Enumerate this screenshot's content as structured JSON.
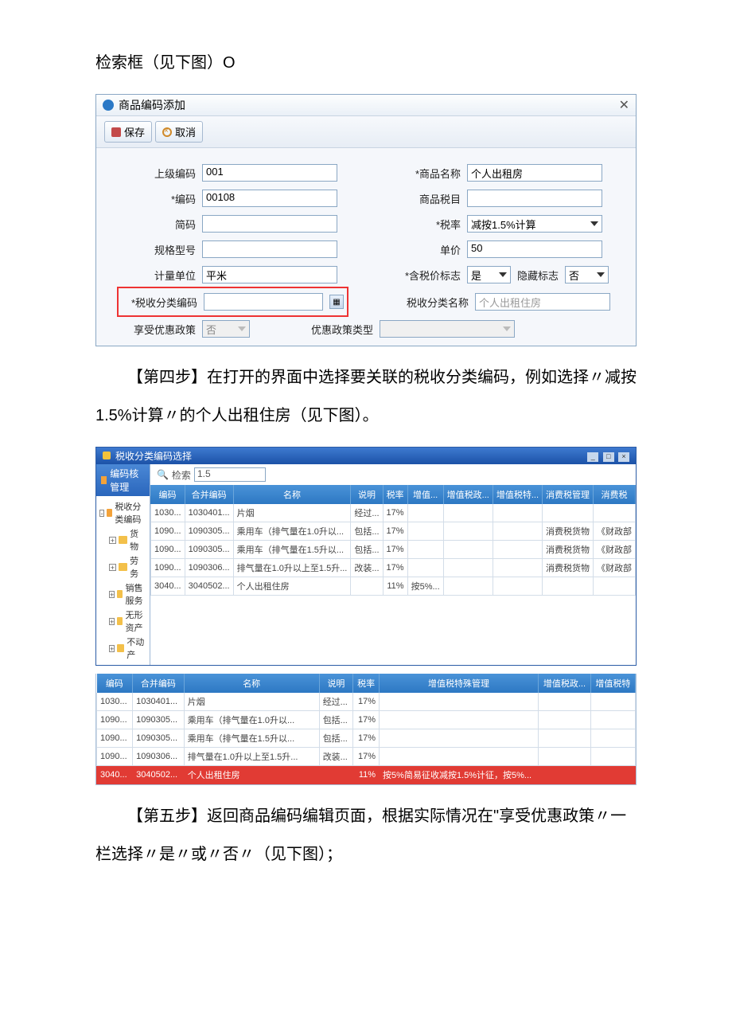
{
  "text1": "检索框（见下图）O",
  "text2": "【第四步】在打开的界面中选择要关联的税收分类编码，例如选择〃减按 1.5%计算〃的个人出租住房（见下图）。",
  "text3": "【第五步】返回商品编码编辑页面，根据实际情况在\"享受优惠政策〃一栏选择〃是〃或〃否〃（见下图）；",
  "dialog1": {
    "title": "商品编码添加",
    "close": "✕",
    "toolbar": {
      "save": "保存",
      "cancel": "取消"
    },
    "labels": {
      "parentCode": "上级编码",
      "code": "*编码",
      "shortCode": "简码",
      "spec": "规格型号",
      "unit": "计量单位",
      "taxClassCode": "*税收分类编码",
      "preferential": "享受优惠政策",
      "productName": "*商品名称",
      "productTax": "商品税目",
      "taxRate": "*税率",
      "unitPrice": "单价",
      "taxIncFlag": "*含税价标志",
      "hiddenFlag": "隐藏标志",
      "taxClassName": "税收分类名称",
      "prefType": "优惠政策类型"
    },
    "values": {
      "parentCode": "001",
      "code": "00108",
      "unit": "平米",
      "preferential": "否",
      "productName": "个人出租房",
      "taxRate": "减按1.5%计算",
      "unitPrice": "50",
      "taxIncFlag": "是",
      "hiddenFlag": "否",
      "taxClassName": "个人出租住房"
    }
  },
  "dialog2": {
    "title": "税收分类编码选择",
    "sideTitle": "编码核管理",
    "searchLabel": "检索",
    "searchValue": "1.5",
    "tree": {
      "root": "税收分类编码",
      "n1": "货物",
      "n2": "劳务",
      "n3": "销售服务",
      "n4": "无形资产",
      "n5": "不动产"
    },
    "headers": [
      "编码",
      "合并编码",
      "名称",
      "说明",
      "税率",
      "增值...",
      "增值税政...",
      "增值税特...",
      "消费税管理",
      "消费税"
    ],
    "rows": [
      {
        "c0": "1030...",
        "c1": "1030401...",
        "c2": "片烟",
        "c3": "经过...",
        "c4": "17%",
        "c5": "",
        "c6": "",
        "c7": "",
        "c8": "",
        "c9": ""
      },
      {
        "c0": "1090...",
        "c1": "1090305...",
        "c2": "乘用车（排气量在1.0升以...",
        "c3": "包括...",
        "c4": "17%",
        "c5": "",
        "c6": "",
        "c7": "",
        "c8": "消费税货物",
        "c9": "《财政部"
      },
      {
        "c0": "1090...",
        "c1": "1090305...",
        "c2": "乘用车（排气量在1.5升以...",
        "c3": "包括...",
        "c4": "17%",
        "c5": "",
        "c6": "",
        "c7": "",
        "c8": "消费税货物",
        "c9": "《财政部"
      },
      {
        "c0": "1090...",
        "c1": "1090306...",
        "c2": "排气量在1.0升以上至1.5升...",
        "c3": "改装...",
        "c4": "17%",
        "c5": "",
        "c6": "",
        "c7": "",
        "c8": "消费税货物",
        "c9": "《财政部"
      },
      {
        "c0": "3040...",
        "c1": "3040502...",
        "c2": "个人出租住房",
        "c3": "",
        "c4": "11%",
        "c5": "按5%...",
        "c6": "",
        "c7": "",
        "c8": "",
        "c9": ""
      }
    ]
  },
  "table3": {
    "headers": [
      "编码",
      "合并编码",
      "名称",
      "说明",
      "税率",
      "增值税特殊管理",
      "增值税政...",
      "增值税特"
    ],
    "rows": [
      {
        "c0": "1030...",
        "c1": "1030401...",
        "c2": "片烟",
        "c3": "经过...",
        "c4": "17%",
        "c5": "",
        "c6": "",
        "c7": ""
      },
      {
        "c0": "1090...",
        "c1": "1090305...",
        "c2": "乘用车（排气量在1.0升以...",
        "c3": "包括...",
        "c4": "17%",
        "c5": "",
        "c6": "",
        "c7": ""
      },
      {
        "c0": "1090...",
        "c1": "1090305...",
        "c2": "乘用车（排气量在1.5升以...",
        "c3": "包括...",
        "c4": "17%",
        "c5": "",
        "c6": "",
        "c7": ""
      },
      {
        "c0": "1090...",
        "c1": "1090306...",
        "c2": "排气量在1.0升以上至1.5升...",
        "c3": "改装...",
        "c4": "17%",
        "c5": "",
        "c6": "",
        "c7": ""
      }
    ],
    "lastRow": {
      "c0": "3040...",
      "c1": "3040502...",
      "c2": "个人出租住房",
      "c3": "",
      "c4": "11%",
      "c5": "按5%简易征收减按1.5%计征，按5%...",
      "c6": "",
      "c7": ""
    }
  }
}
